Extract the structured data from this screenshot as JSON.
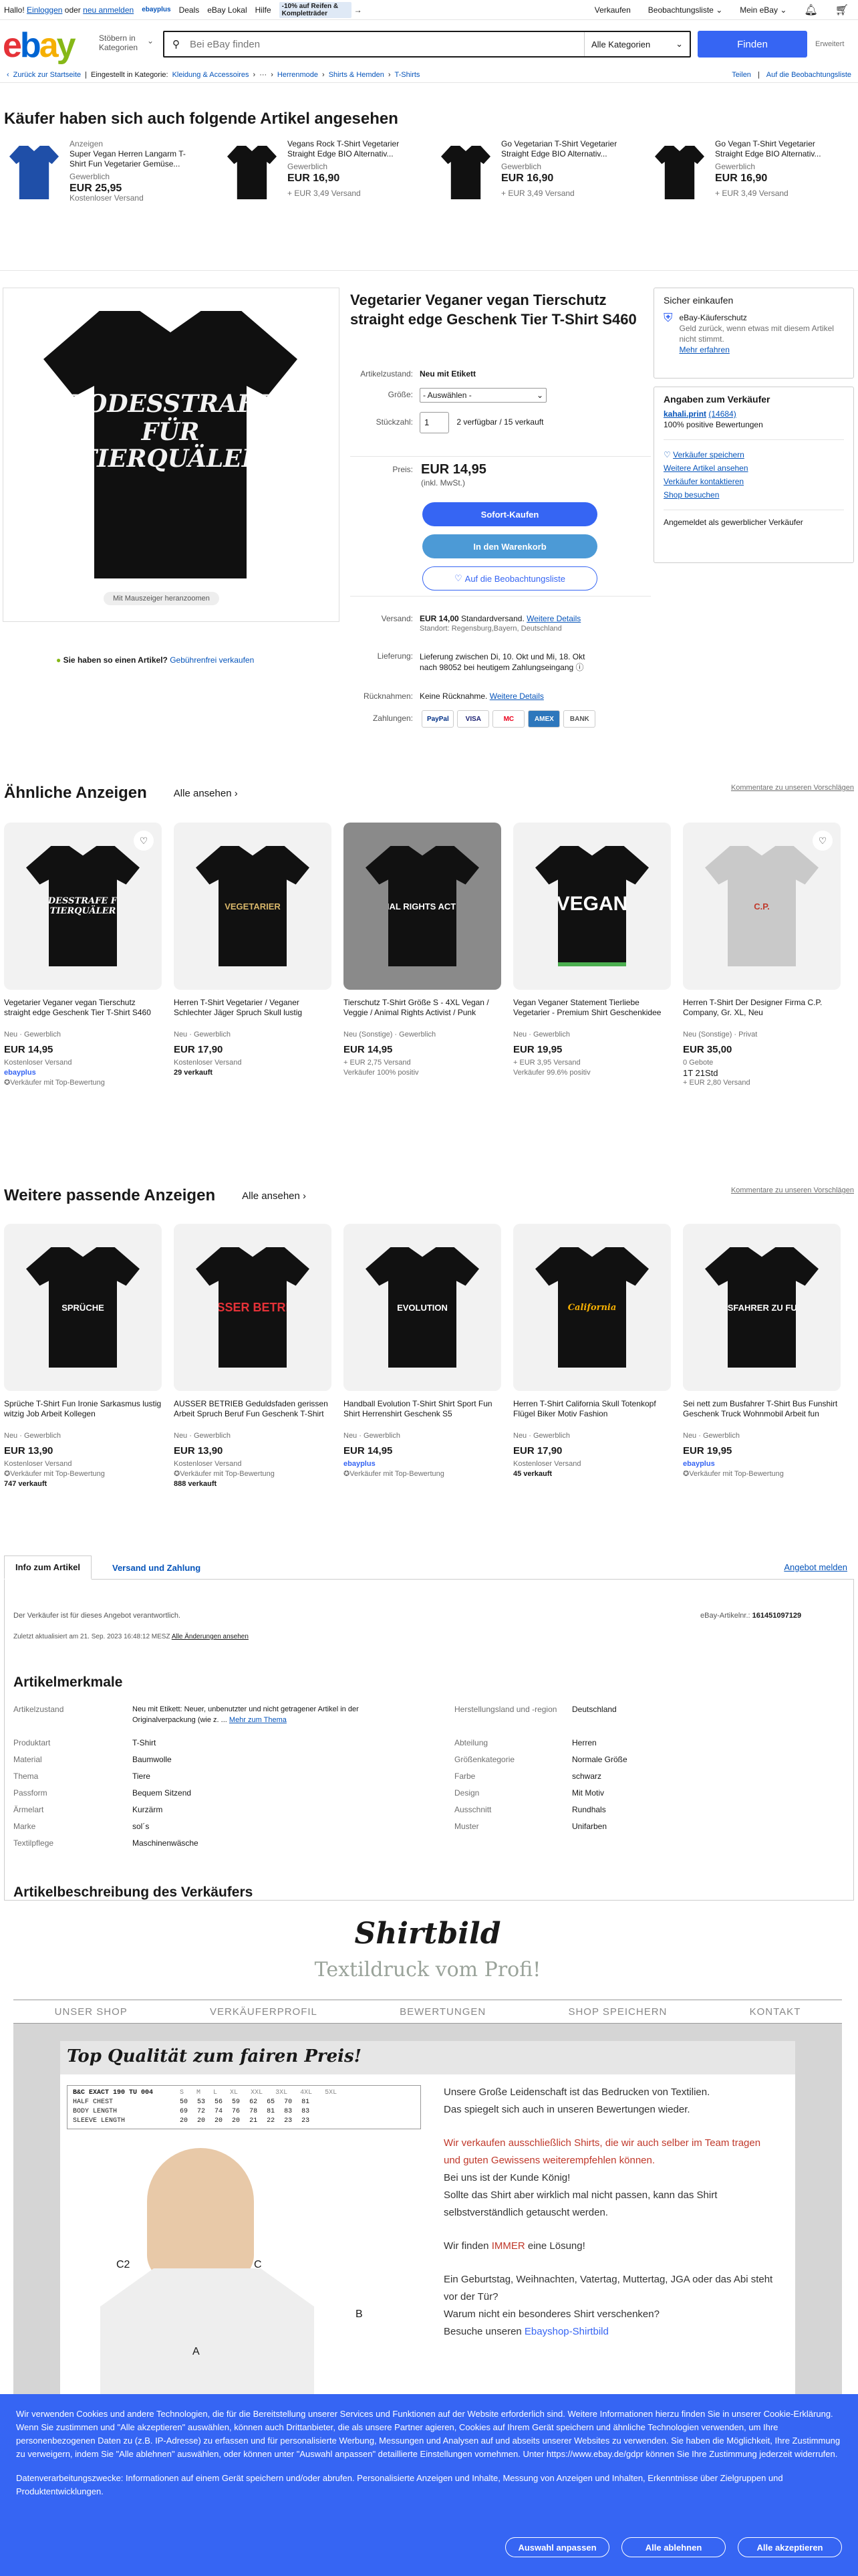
{
  "topbar": {
    "greeting": "Hallo!",
    "login": "Einloggen",
    "or": "oder",
    "register": "neu anmelden",
    "ebayplus": "ebayplus",
    "deals": "Deals",
    "local": "eBay Lokal",
    "help": "Hilfe",
    "promo": "-10% auf Reifen & Kompletträder",
    "sell": "Verkaufen",
    "watchlist": "Beobachtungsliste",
    "myebay": "Mein eBay"
  },
  "header": {
    "logo": [
      "e",
      "b",
      "a",
      "y"
    ],
    "category_btn": "Stöbern in Kategorien",
    "search_placeholder": "Bei eBay finden",
    "category_select": "Alle Kategorien",
    "search_btn": "Finden",
    "advanced": "Erweitert"
  },
  "breadcrumb": {
    "back": "Zurück zur Startseite",
    "listed": "Eingestellt in Kategorie:",
    "items": [
      "Kleidung & Accessoires",
      "Herrenmode",
      "Shirts & Hemden",
      "T-Shirts"
    ],
    "share": "Teilen",
    "watch": "Auf die Beobachtungsliste"
  },
  "also_viewed": {
    "title": "Käufer haben sich auch folgende Artikel angesehen",
    "items": [
      {
        "tag": "Anzeigen",
        "title": "Super Vegan Herren Langarm T-Shirt Fun Vegetarier Gemüse...",
        "cond": "Gewerblich",
        "price": "EUR 25,95",
        "ship": "Kostenloser Versand"
      },
      {
        "tag": "",
        "title": "Vegans Rock T-Shirt Vegetarier Straight Edge BIO Alternativ...",
        "cond": "Gewerblich",
        "price": "EUR 16,90",
        "ship": "+ EUR 3,49 Versand"
      },
      {
        "tag": "",
        "title": "Go Vegetarian T-Shirt Vegetarier Straight Edge BIO Alternativ...",
        "cond": "Gewerblich",
        "price": "EUR 16,90",
        "ship": "+ EUR 3,49 Versand"
      },
      {
        "tag": "",
        "title": "Go Vegan T-Shirt Vegetarier Straight Edge BIO Alternativ...",
        "cond": "Gewerblich",
        "price": "EUR 16,90",
        "ship": "+ EUR 3,49 Versand"
      }
    ]
  },
  "product": {
    "image_text_1": "TODESSTRAFE",
    "image_text_2": "FÜR",
    "image_text_3": "TIERQUÄLER",
    "zoom": "Mit Mauszeiger heranzoomen",
    "sell_q": "Sie haben so einen Artikel?",
    "sell_link": "Gebührenfrei verkaufen",
    "title": "Vegetarier Veganer vegan Tierschutz straight edge Geschenk Tier T-Shirt S460",
    "condition_label": "Artikelzustand:",
    "condition": "Neu mit Etikett",
    "size_label": "Größe:",
    "size_value": "- Auswählen -",
    "qty_label": "Stückzahl:",
    "qty_value": "1",
    "avail": "2 verfügbar / 15 verkauft",
    "price_label": "Preis:",
    "price": "EUR 14,95",
    "vat": "(inkl. MwSt.)",
    "buy_now": "Sofort-Kaufen",
    "add_cart": "In den Warenkorb",
    "watch": "Auf die Beobachtungsliste",
    "shipping_label": "Versand:",
    "shipping": "EUR 14,00",
    "shipping_type": "Standardversand.",
    "shipping_more": "Weitere Details",
    "location": "Standort: Regensburg,Bayern, Deutschland",
    "delivery_label": "Lieferung:",
    "delivery": "Lieferung zwischen Di, 10. Okt und Mi, 18. Okt",
    "delivery_2": "nach 98052 bei heutigem Zahlungseingang",
    "returns_label": "Rücknahmen:",
    "returns": "Keine Rücknahme.",
    "returns_more": "Weitere Details",
    "payments_label": "Zahlungen:",
    "payments": [
      "PayPal",
      "VISA",
      "MC",
      "AMEX",
      "BANK"
    ]
  },
  "side": {
    "safe_title": "Sicher einkaufen",
    "guarantee": "eBay-Käuferschutz",
    "guarantee_text": "Geld zurück, wenn etwas mit diesem Artikel nicht stimmt.",
    "learn": "Mehr erfahren",
    "seller_title": "Angaben zum Verkäufer",
    "seller": "kahali.print",
    "seller_score": "(14684)",
    "positive": "100% positive Bewertungen",
    "save_seller": "Verkäufer speichern",
    "other_items": "Weitere Artikel ansehen",
    "contact": "Verkäufer kontaktieren",
    "shop": "Shop besuchen",
    "business": "Angemeldet als gewerblicher Verkäufer"
  },
  "similar": {
    "title": "Ähnliche Anzeigen",
    "see_all": "Alle ansehen",
    "feedback": "Kommentare zu unseren Vorschlägen",
    "items": [
      {
        "img": "TODESSTRAFE FÜR TIERQUÄLER",
        "title": "Vegetarier Veganer vegan Tierschutz straight edge Geschenk Tier T-Shirt S460",
        "cond": "Neu · Gewerblich",
        "price": "EUR 14,95",
        "x1": "Kostenloser Versand",
        "x2": "ebayplus",
        "x3": "Verkäufer mit Top-Bewertung"
      },
      {
        "img": "VEGETARIER",
        "title": "Herren T-Shirt Vegetarier / Veganer Schlechter Jäger Spruch Skull lustig",
        "cond": "Neu · Gewerblich",
        "price": "EUR 17,90",
        "x1": "Kostenloser Versand",
        "x2": "29 verkauft",
        "x3": ""
      },
      {
        "img": "ANIMAL RIGHTS ACTIVIST",
        "title": "Tierschutz T-Shirt Größe S - 4XL Vegan / Veggie / Animal Rights Activist / Punk",
        "cond": "Neu (Sonstige) · Gewerblich",
        "price": "EUR 14,95",
        "x1": "+ EUR 2,75 Versand",
        "x2": "Verkäufer 100% positiv",
        "x3": ""
      },
      {
        "img": "VEGAN",
        "title": "Vegan Veganer Statement Tierliebe Vegetarier - Premium Shirt Geschenkidee",
        "cond": "Neu · Gewerblich",
        "price": "EUR 19,95",
        "x1": "+ EUR 3,95 Versand",
        "x2": "Verkäufer 99.6% positiv",
        "x3": ""
      },
      {
        "img": "C.P.",
        "title": "Herren T-Shirt Der Designer Firma C.P. Company, Gr. XL, Neu",
        "cond": "Neu (Sonstige) · Privat",
        "price": "EUR 35,00",
        "x1": "0 Gebote",
        "x2": "1T 21Std",
        "x3": "+ EUR 2,80 Versand"
      }
    ]
  },
  "more": {
    "title": "Weitere passende Anzeigen",
    "see_all": "Alle ansehen",
    "feedback": "Kommentare zu unseren Vorschlägen",
    "items": [
      {
        "img": "SPRÜCHE",
        "title": "Sprüche T-Shirt Fun Ironie Sarkasmus lustig witzig Job Arbeit Kollegen",
        "cond": "Neu · Gewerblich",
        "price": "EUR 13,90",
        "x1": "Kostenloser Versand",
        "x2": "Verkäufer mit Top-Bewertung",
        "x3": "747 verkauft"
      },
      {
        "img": "AUSSER BETRIEB",
        "title": "AUSSER BETRIEB Geduldsfaden gerissen Arbeit Spruch Beruf Fun Geschenk T-Shirt",
        "cond": "Neu · Gewerblich",
        "price": "EUR 13,90",
        "x1": "Kostenloser Versand",
        "x2": "Verkäufer mit Top-Bewertung",
        "x3": "888 verkauft"
      },
      {
        "img": "EVOLUTION",
        "title": "Handball Evolution T-Shirt Shirt Sport Fun Shirt Herrenshirt Geschenk S5",
        "cond": "Neu · Gewerblich",
        "price": "EUR 14,95",
        "x1": "ebayplus",
        "x2": "Verkäufer mit Top-Bewertung",
        "x3": ""
      },
      {
        "img": "California",
        "title": "Herren T-Shirt California Skull Totenkopf Flügel Biker Motiv Fashion",
        "cond": "Neu · Gewerblich",
        "price": "EUR 17,90",
        "x1": "Kostenloser Versand",
        "x2": "45 verkauft",
        "x3": ""
      },
      {
        "img": "BUSFAHRER ZU FUSS",
        "title": "Sei nett zum Busfahrer T-Shirt Bus Funshirt Geschenk Truck Wohnmobil Arbeit fun",
        "cond": "Neu · Gewerblich",
        "price": "EUR 19,95",
        "x1": "ebayplus",
        "x2": "Verkäufer mit Top-Bewertung",
        "x3": ""
      }
    ]
  },
  "tabs": {
    "t1": "Info zum Artikel",
    "t2": "Versand und Zahlung",
    "report": "Angebot melden"
  },
  "itemInfo": {
    "responsible": "Der Verkäufer ist für dieses Angebot verantwortlich.",
    "item_no_label": "eBay-Artikelnr.:",
    "item_no": "161451097129",
    "updated": "Zuletzt aktualisiert am 21. Sep. 2023 16:48:12 MESZ",
    "changes": "Alle Änderungen ansehen"
  },
  "specs": {
    "title": "Artikelmerkmale",
    "left": [
      {
        "k": "Artikelzustand",
        "v": "Neu mit Etikett: Neuer, unbenutzter und nicht getragener Artikel in der Originalverpackung (wie z. ...",
        "more": "Mehr zum Thema"
      },
      {
        "k": "Produktart",
        "v": "T-Shirt"
      },
      {
        "k": "Material",
        "v": "Baumwolle"
      },
      {
        "k": "Thema",
        "v": "Tiere"
      },
      {
        "k": "Passform",
        "v": "Bequem Sitzend"
      },
      {
        "k": "Ärmelart",
        "v": "Kurzärm"
      },
      {
        "k": "Marke",
        "v": "sol´s"
      },
      {
        "k": "Textilpflege",
        "v": "Maschinenwäsche"
      }
    ],
    "right": [
      {
        "k": "Herstellungsland und -region",
        "v": "Deutschland"
      },
      {
        "k": "Abteilung",
        "v": "Herren"
      },
      {
        "k": "Größenkategorie",
        "v": "Normale Größe"
      },
      {
        "k": "Farbe",
        "v": "schwarz"
      },
      {
        "k": "Design",
        "v": "Mit Motiv"
      },
      {
        "k": "Ausschnitt",
        "v": "Rundhals"
      },
      {
        "k": "Muster",
        "v": "Unifarben"
      }
    ]
  },
  "description": {
    "title": "Artikelbeschreibung des Verkäufers",
    "brand": "Shirtbild",
    "subtitle": "Textildruck vom Profi!",
    "nav": [
      "UNSER SHOP",
      "VERKÄUFERPROFIL",
      "BEWERTUNGEN",
      "SHOP SPEICHERN",
      "KONTAKT"
    ],
    "banner": "Top Qualität zum fairen Preis!",
    "size_table_head": "B&C EXACT 190 TU 004",
    "size_cols": [
      "S",
      "M",
      "L",
      "XL",
      "XXL",
      "3XL",
      "4XL",
      "5XL"
    ],
    "size_rows": [
      {
        "l": "HALF CHEST",
        "v": [
          "50",
          "53",
          "56",
          "59",
          "62",
          "65",
          "70",
          "81"
        ]
      },
      {
        "l": "BODY LENGTH",
        "v": [
          "69",
          "72",
          "74",
          "76",
          "78",
          "81",
          "83",
          "83"
        ]
      },
      {
        "l": "SLEEVE LENGTH",
        "v": [
          "20",
          "20",
          "20",
          "20",
          "21",
          "22",
          "23",
          "23"
        ]
      }
    ],
    "p1": "Unsere Große Leidenschaft ist das Bedrucken von Textilien.",
    "p2": "Das spiegelt sich auch in unseren Bewertungen wieder.",
    "p3": "Wir verkaufen ausschließlich Shirts, die wir auch selber im Team tragen und guten Gewissens weiterempfehlen können.",
    "p4": "Bei uns ist der Kunde König!",
    "p5": "Sollte das Shirt aber wirklich mal nicht passen, kann das Shirt selbstverständlich getauscht werden.",
    "p6a": "Wir finden ",
    "p6b": "IMMER",
    "p6c": " eine Lösung!",
    "p7": "Ein Geburtstag, Weihnachten, Vatertag, Muttertag, JGA oder das Abi steht vor der Tür?",
    "p8": "Warum nicht ein besonderes Shirt verschenken?",
    "p9a": "Besuche unseren ",
    "p9b": "Ebayshop-Shirtbild",
    "labels": [
      "C2",
      "C",
      "A",
      "B"
    ]
  },
  "cookie": {
    "text": "Wir verwenden Cookies und andere Technologien, die für die Bereitstellung unserer Services und Funktionen auf der Website erforderlich sind. Weitere Informationen hierzu finden Sie in unserer Cookie-Erklärung. Wenn Sie zustimmen und \"Alle akzeptieren\" auswählen, können auch Drittanbieter, die als unsere Partner agieren, Cookies auf Ihrem Gerät speichern und ähnliche Technologien verwenden, um Ihre personenbezogenen Daten zu (z.B. IP-Adresse) zu erfassen und für personalisierte Werbung, Messungen und Analysen auf und abseits unserer Websites zu verwenden. Sie haben die Möglichkeit, Ihre Zustimmung zu verweigern, indem Sie \"Alle ablehnen\" auswählen, oder können unter \"Auswahl anpassen\" detaillierte Einstellungen vornehmen. Unter https://www.ebay.de/gdpr können Sie Ihre Zustimmung jederzeit widerrufen.",
    "text2": "Datenverarbeitungszwecke: Informationen auf einem Gerät speichern und/oder abrufen. Personalisierte Anzeigen und Inhalte, Messung von Anzeigen und Inhalten, Erkenntnisse über Zielgruppen und Produktentwicklungen.",
    "customize": "Auswahl anpassen",
    "reject": "Alle ablehnen",
    "accept": "Alle akzeptieren"
  }
}
